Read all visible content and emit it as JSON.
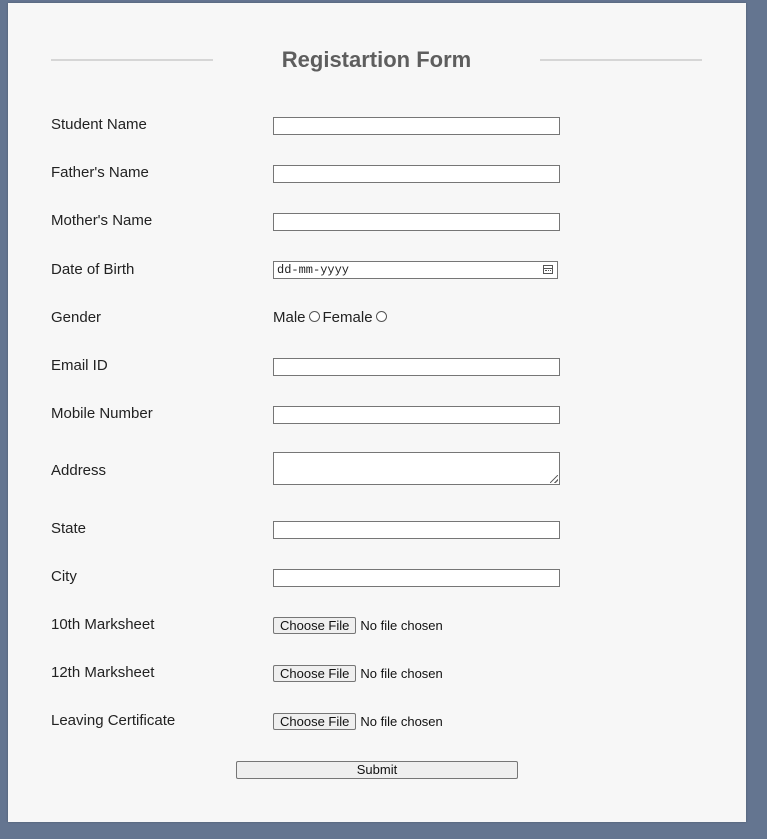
{
  "form": {
    "title": "Registartion Form",
    "fields": {
      "student_name": {
        "label": "Student Name",
        "value": ""
      },
      "father_name": {
        "label": "Father's Name",
        "value": ""
      },
      "mother_name": {
        "label": "Mother's Name",
        "value": ""
      },
      "dob": {
        "label": "Date of Birth",
        "placeholder": "dd-mm-yyyy"
      },
      "gender": {
        "label": "Gender",
        "options": [
          "Male",
          "Female"
        ]
      },
      "email": {
        "label": "Email ID",
        "value": ""
      },
      "mobile": {
        "label": "Mobile Number",
        "value": ""
      },
      "address": {
        "label": "Address",
        "value": ""
      },
      "state": {
        "label": "State",
        "value": ""
      },
      "city": {
        "label": "City",
        "value": ""
      },
      "marksheet10": {
        "label": "10th Marksheet",
        "button": "Choose File",
        "status": "No file chosen"
      },
      "marksheet12": {
        "label": "12th Marksheet",
        "button": "Choose File",
        "status": "No file chosen"
      },
      "leaving_cert": {
        "label": "Leaving Certificate",
        "button": "Choose File",
        "status": "No file chosen"
      }
    },
    "submit_label": "Submit"
  },
  "colors": {
    "background": "#647590",
    "card": "#f7f7f7",
    "title": "#5e5e5e"
  }
}
